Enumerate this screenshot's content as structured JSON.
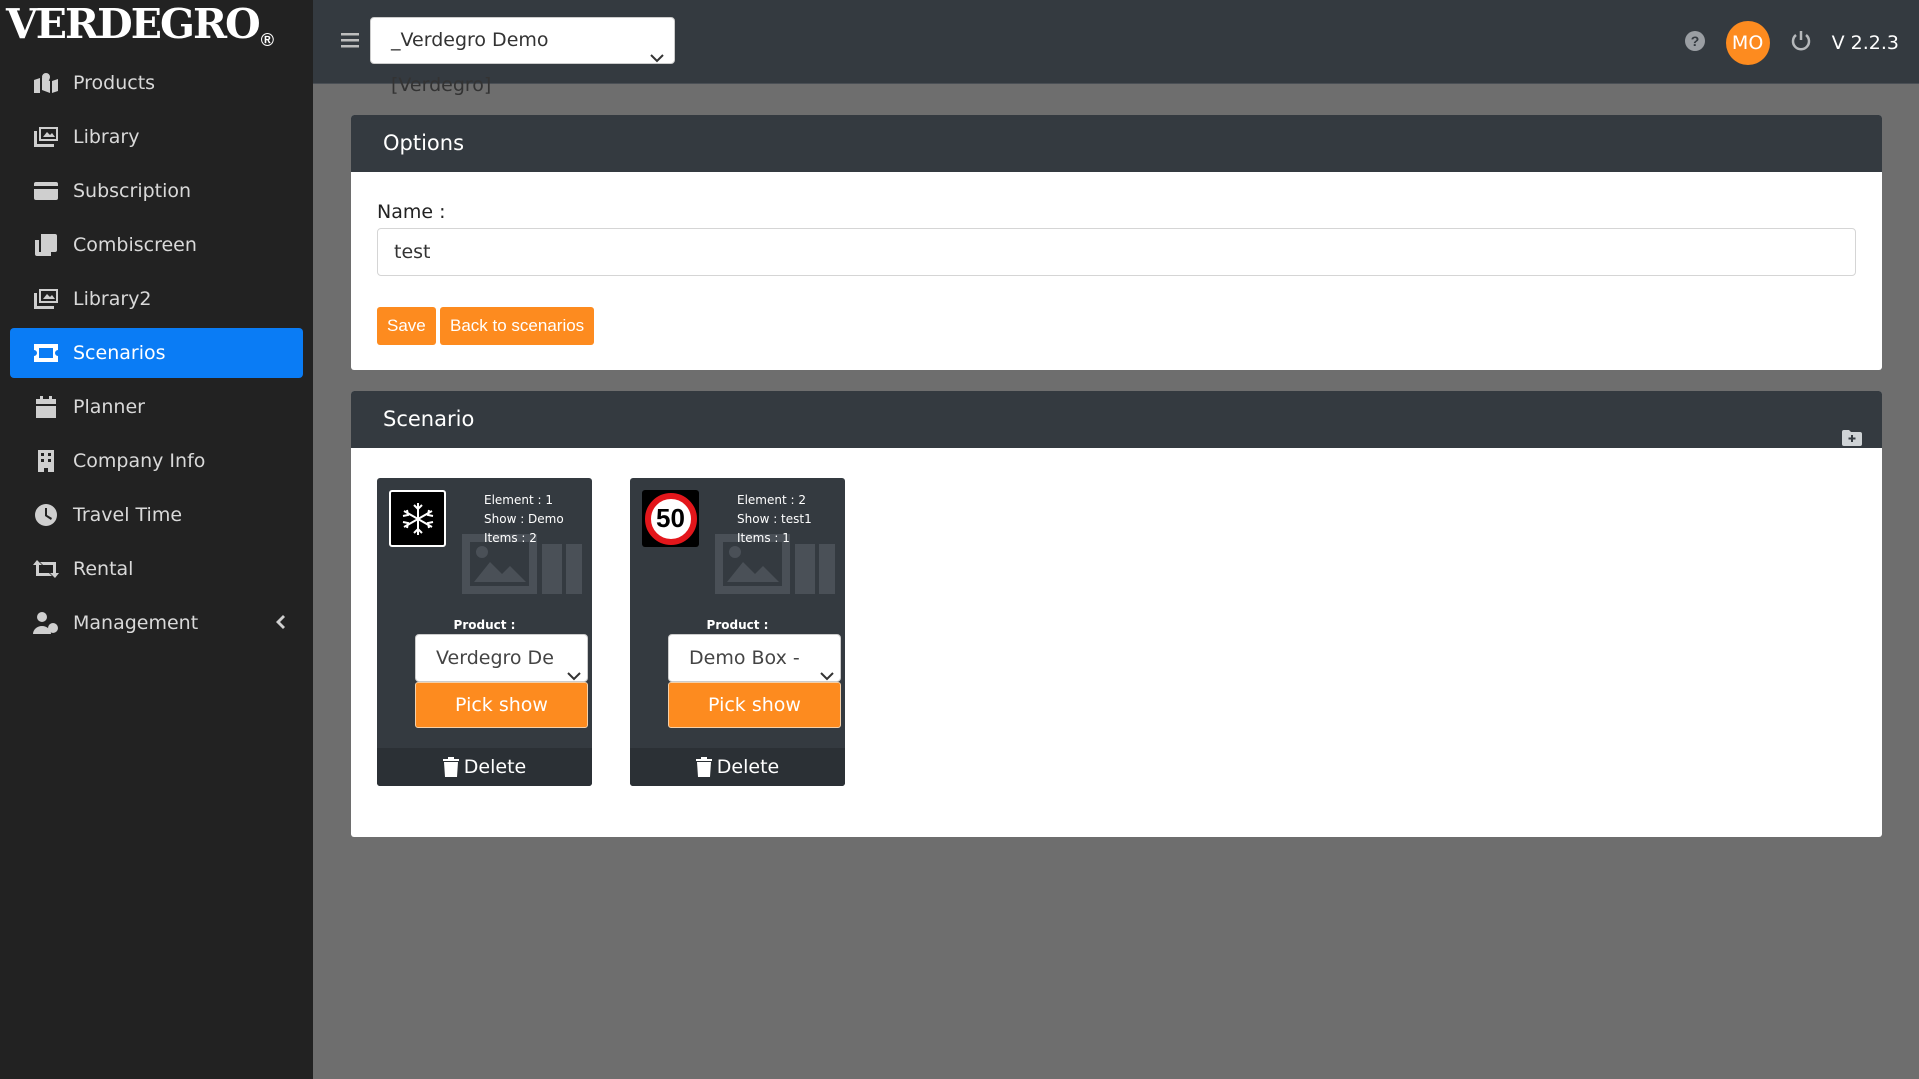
{
  "brand": {
    "logo_text": "VERDEGRO",
    "registered": "®"
  },
  "sidebar": {
    "items": [
      {
        "label": "Products",
        "icon": "map-marker-icon",
        "active": false
      },
      {
        "label": "Library",
        "icon": "images-icon",
        "active": false
      },
      {
        "label": "Subscription",
        "icon": "credit-card-icon",
        "active": false
      },
      {
        "label": "Combiscreen",
        "icon": "clone-icon",
        "active": false
      },
      {
        "label": "Library2",
        "icon": "images-icon",
        "active": false
      },
      {
        "label": "Scenarios",
        "icon": "ticket-icon",
        "active": true
      },
      {
        "label": "Planner",
        "icon": "calendar-icon",
        "active": false
      },
      {
        "label": "Company Info",
        "icon": "building-icon",
        "active": false
      },
      {
        "label": "Travel Time",
        "icon": "clock-icon",
        "active": false
      },
      {
        "label": "Rental",
        "icon": "retweet-icon",
        "active": false
      },
      {
        "label": "Management",
        "icon": "users-cog-icon",
        "active": false,
        "has_chevron": true
      }
    ],
    "active_color": "#0a7cf5"
  },
  "topbar": {
    "company_selected": "_Verdegro Demo [Verdegro]",
    "avatar_initials": "MO",
    "avatar_color": "#fd8b1f",
    "version": "V 2.2.3"
  },
  "options": {
    "title": "Options",
    "name_label": "Name :",
    "name_value": "test",
    "save_label": "Save",
    "back_label": "Back to scenarios"
  },
  "scenario": {
    "title": "Scenario",
    "cards": [
      {
        "thumb": "snowflake-icon",
        "element": "Element : 1",
        "show": "Show : Demo",
        "items": "Items : 2",
        "product_label": "Product :",
        "product_value": "Verdegro Demo",
        "pick_label": "Pick show",
        "delete_label": "Delete"
      },
      {
        "thumb": "speed-limit-50-icon",
        "thumb_text": "50",
        "element": "Element : 2",
        "show": "Show : test1",
        "items": "Items : 1",
        "product_label": "Product :",
        "product_value": "Demo Box - M",
        "pick_label": "Pick show",
        "delete_label": "Delete"
      }
    ]
  },
  "colors": {
    "accent": "#fd8b1f",
    "dark": "#343a40",
    "sidebar": "#222222"
  }
}
